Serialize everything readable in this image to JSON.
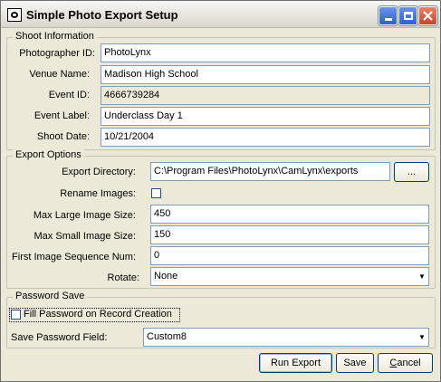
{
  "window": {
    "title": "Simple Photo Export Setup",
    "buttons": {
      "minimize": "minimize-icon",
      "maximize": "maximize-icon",
      "close": "close-icon"
    }
  },
  "shoot": {
    "group_label": "Shoot Information",
    "photographer_id": {
      "label": "Photographer ID:",
      "value": "PhotoLynx"
    },
    "venue_name": {
      "label": "Venue Name:",
      "value": "Madison High School"
    },
    "event_id": {
      "label": "Event ID:",
      "value": "4666739284"
    },
    "event_label": {
      "label": "Event Label:",
      "value": "Underclass Day 1"
    },
    "shoot_date": {
      "label": "Shoot Date:",
      "value": "10/21/2004"
    }
  },
  "export": {
    "group_label": "Export Options",
    "directory": {
      "label": "Export Directory:",
      "value": "C:\\Program Files\\PhotoLynx\\CamLynx\\exports",
      "browse_label": "..."
    },
    "rename_images": {
      "label": "Rename Images:",
      "checked": false
    },
    "max_large": {
      "label": "Max Large Image Size:",
      "value": "450"
    },
    "max_small": {
      "label": "Max Small Image Size:",
      "value": "150"
    },
    "first_seq": {
      "label": "First Image Sequence Num:",
      "value": "0"
    },
    "rotate": {
      "label": "Rotate:",
      "value": "None"
    }
  },
  "password": {
    "group_label": "Password Save",
    "fill_password": {
      "label": "Fill Password on Record Creation",
      "checked": false
    },
    "save_field": {
      "label": "Save Password Field:",
      "value": "Custom8"
    }
  },
  "actions": {
    "run_export": "Run Export",
    "save": "Save",
    "cancel": "Cancel"
  }
}
